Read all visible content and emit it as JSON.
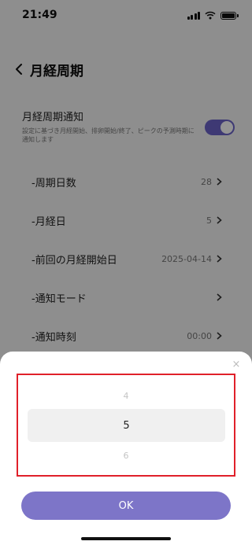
{
  "statusbar": {
    "time": "21:49"
  },
  "header": {
    "title": "月経周期"
  },
  "notification": {
    "title": "月経周期通知",
    "description": "設定に基づき月経開始、排卵開始/終了、ピークの予測時期に通知します",
    "enabled": true
  },
  "settings": [
    {
      "label": "-周期日数",
      "value": "28"
    },
    {
      "label": "-月経日",
      "value": "5"
    },
    {
      "label": "-前回の月経開始日",
      "value": "2025-04-14"
    },
    {
      "label": "-通知モード",
      "value": ""
    },
    {
      "label": "-通知時刻",
      "value": "00:00"
    }
  ],
  "picker": {
    "prev": "4",
    "selected": "5",
    "next": "6"
  },
  "sheet": {
    "ok_label": "OK",
    "close_symbol": "×"
  },
  "colors": {
    "accent": "#7d75c8",
    "toggle": "#6b63c9",
    "highlight_border": "#e0202a"
  }
}
